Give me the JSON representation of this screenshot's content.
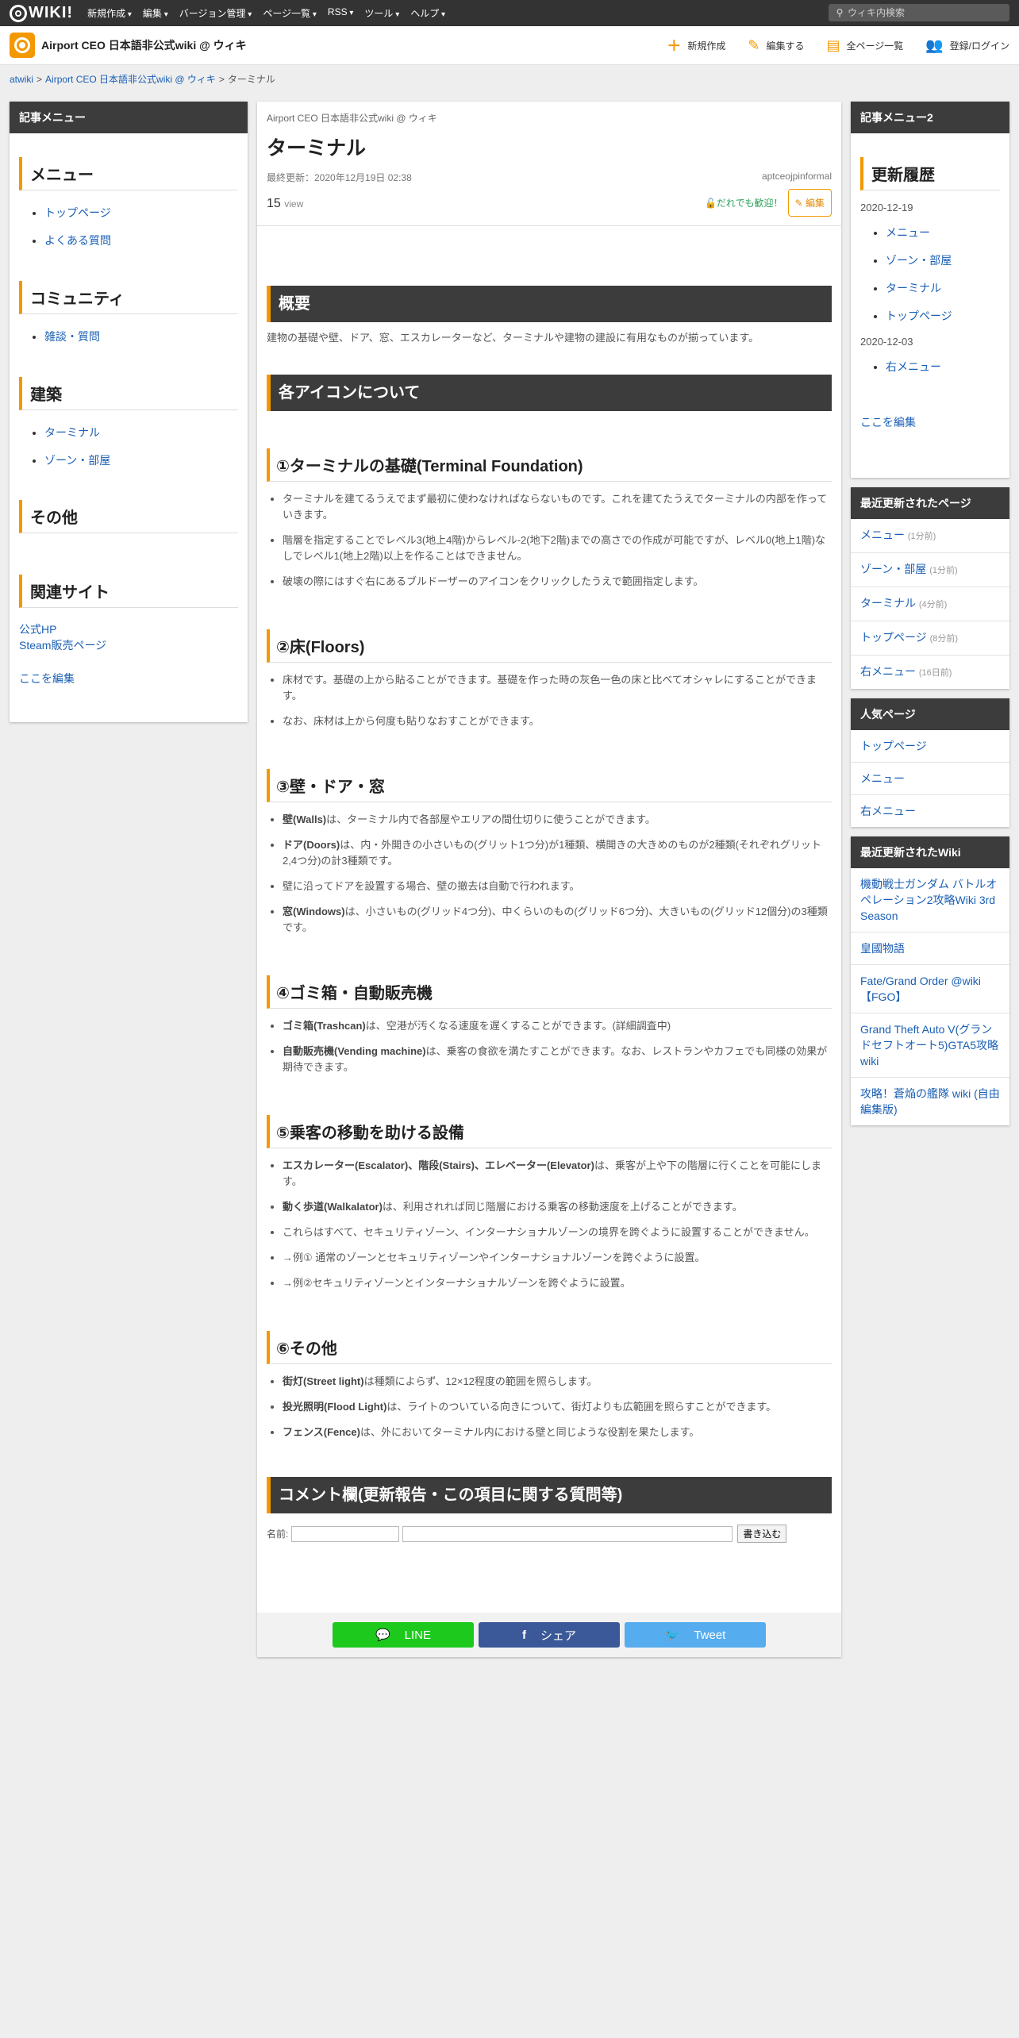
{
  "topbar": {
    "logo": "WIKI!",
    "nav": [
      "新規作成",
      "編集",
      "バージョン管理",
      "ページ一覧",
      "RSS",
      "ツール",
      "ヘルプ"
    ],
    "search_placeholder": "ウィキ内検索"
  },
  "header": {
    "title": "Airport CEO 日本語非公式wiki @ ウィキ",
    "actions": [
      {
        "label": "新規作成",
        "icon": "plus-icon"
      },
      {
        "label": "編集する",
        "icon": "pencil-icon"
      },
      {
        "label": "全ページ一覧",
        "icon": "pages-icon"
      },
      {
        "label": "登録/ログイン",
        "icon": "users-icon"
      }
    ]
  },
  "breadcrumb": {
    "items": [
      "atwiki",
      "Airport CEO 日本語非公式wiki @ ウィキ",
      "ターミナル"
    ],
    "sep": ">"
  },
  "left": {
    "head": "記事メニュー",
    "sections": [
      {
        "title": "メニュー",
        "links": [
          "トップページ",
          "よくある質問"
        ]
      },
      {
        "title": "コミュニティ",
        "links": [
          "雑談・質問"
        ]
      },
      {
        "title": "建築",
        "links": [
          "ターミナル",
          "ゾーン・部屋"
        ]
      },
      {
        "title": "その他",
        "links": []
      },
      {
        "title": "関連サイト",
        "links": []
      }
    ],
    "related": [
      "公式HP",
      "Steam販売ページ"
    ],
    "edit_here": "ここを編集"
  },
  "main": {
    "site": "Airport CEO 日本語非公式wiki @ ウィキ",
    "title": "ターミナル",
    "updated": "最終更新：2020年12月19日 02:38",
    "author": "aptceojpinformal",
    "views": "15",
    "views_unit": "view",
    "welcome": "だれでも歓迎！",
    "edit_btn": "編集",
    "overview_h": "概要",
    "overview_text": "建物の基礎や壁、ドア、窓、エスカレーターなど、ターミナルや建物の建設に有用なものが揃っています。",
    "icons_h": "各アイコンについて",
    "s1": {
      "h": "①ターミナルの基礎(Terminal Foundation)",
      "items": [
        "ターミナルを建てるうえでまず最初に使わなければならないものです。これを建てたうえでターミナルの内部を作っていきます。",
        "階層を指定することでレベル3(地上4階)からレベル-2(地下2階)までの高さでの作成が可能ですが、レベル0(地上1階)なしでレベル1(地上2階)以上を作ることはできません。",
        "破壊の際にはすぐ右にあるブルドーザーのアイコンをクリックしたうえで範囲指定します。"
      ]
    },
    "s2": {
      "h": "②床(Floors)",
      "items": [
        "床材です。基礎の上から貼ることができます。基礎を作った時の灰色一色の床と比べてオシャレにすることができます。",
        "なお、床材は上から何度も貼りなおすことができます。"
      ]
    },
    "s3": {
      "h": "③壁・ドア・窓",
      "items": [
        {
          "b": "壁(Walls)",
          "t": "は、ターミナル内で各部屋やエリアの間仕切りに使うことができます。"
        },
        {
          "b": "ドア(Doors)",
          "t": "は、内・外開きの小さいもの(グリット1つ分)が1種類、横開きの大きめのものが2種類(それぞれグリット2,4つ分)の計3種類です。"
        },
        {
          "b": "",
          "t": "壁に沿ってドアを設置する場合、壁の撤去は自動で行われます。"
        },
        {
          "b": "窓(Windows)",
          "t": "は、小さいもの(グリッド4つ分)、中くらいのもの(グリッド6つ分)、大きいもの(グリッド12個分)の3種類です。"
        }
      ]
    },
    "s4": {
      "h": "④ゴミ箱・自動販売機",
      "items": [
        {
          "b": "ゴミ箱(Trashcan)",
          "t": "は、空港が汚くなる速度を遅くすることができます。(詳細調査中)"
        },
        {
          "b": "自動販売機(Vending machine)",
          "t": "は、乗客の食欲を満たすことができます。なお、レストランやカフェでも同様の効果が期待できます。"
        }
      ]
    },
    "s5": {
      "h": "⑤乗客の移動を助ける設備",
      "items": [
        {
          "b": "エスカレーター(Escalator)、階段(Stairs)、エレベーター(Elevator)",
          "t": "は、乗客が上や下の階層に行くことを可能にします。"
        },
        {
          "b": "動く歩道(Walkalator)",
          "t": "は、利用されれば同じ階層における乗客の移動速度を上げることができます。"
        },
        {
          "b": "",
          "t": "これらはすべて、セキュリティゾーン、インターナショナルゾーンの境界を跨ぐように設置することができません。"
        },
        {
          "b": "",
          "t": "→例① 通常のゾーンとセキュリティゾーンやインターナショナルゾーンを跨ぐように設置。"
        },
        {
          "b": "",
          "t": "→例②セキュリティゾーンとインターナショナルゾーンを跨ぐように設置。"
        }
      ]
    },
    "s6": {
      "h": "⑥その他",
      "items": [
        {
          "b": "街灯(Street light)",
          "t": "は種類によらず、12×12程度の範囲を照らします。"
        },
        {
          "b": "投光照明(Flood Light)",
          "t": "は、ライトのついている向きについて、街灯よりも広範囲を照らすことができます。"
        },
        {
          "b": "フェンス(Fence)",
          "t": "は、外においてターミナル内における壁と同じような役割を果たします。"
        }
      ]
    },
    "comment_h": "コメント欄(更新報告・この項目に関する質問等)",
    "comment_name_label": "名前:",
    "comment_submit": "書き込む",
    "share": {
      "line": "LINE",
      "facebook": "シェア",
      "twitter": "Tweet"
    },
    "colors": {
      "line": "#1dc91d",
      "facebook": "#3b5998",
      "twitter": "#55acee"
    }
  },
  "right": {
    "head": "記事メニュー2",
    "history_title": "更新履歴",
    "history": [
      {
        "date": "2020-12-19",
        "links": [
          "メニュー",
          "ゾーン・部屋",
          "ターミナル",
          "トップページ"
        ]
      },
      {
        "date": "2020-12-03",
        "links": [
          "右メニュー"
        ]
      }
    ],
    "edit_here": "ここを編集",
    "recent_head": "最近更新されたページ",
    "recent": [
      {
        "name": "メニュー",
        "ago": "(1分前)"
      },
      {
        "name": "ゾーン・部屋",
        "ago": "(1分前)"
      },
      {
        "name": "ターミナル",
        "ago": "(4分前)"
      },
      {
        "name": "トップページ",
        "ago": "(8分前)"
      },
      {
        "name": "右メニュー",
        "ago": "(16日前)"
      }
    ],
    "popular_head": "人気ページ",
    "popular": [
      "トップページ",
      "メニュー",
      "右メニュー"
    ],
    "wiki_head": "最近更新されたWiki",
    "wikis": [
      "機動戦士ガンダム バトルオペレーション2攻略Wiki 3rd Season",
      "皇國物語",
      "Fate/Grand Order @wiki 【FGO】",
      "Grand Theft Auto V(グランドセフトオート5)GTA5攻略wiki",
      "攻略！蒼焔の艦隊 wiki (自由編集版)"
    ]
  }
}
